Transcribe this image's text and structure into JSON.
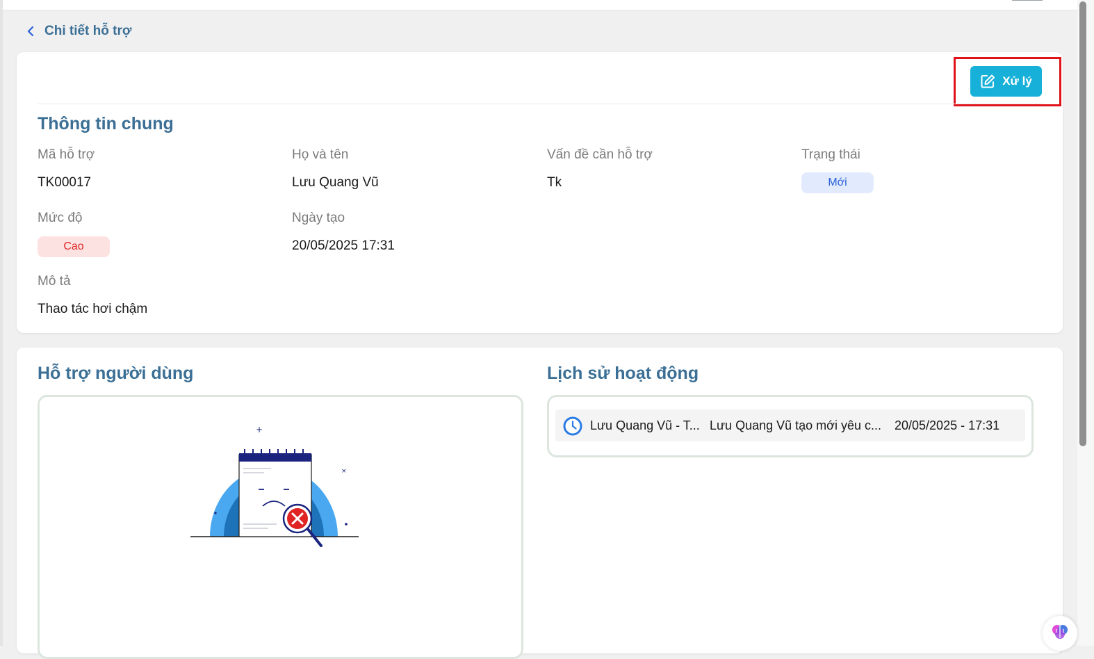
{
  "header": {
    "title": "Chi tiết hỗ trợ",
    "back_icon": "chevron-left-icon"
  },
  "actions": {
    "process_label": "Xử lý",
    "process_icon": "edit-icon",
    "process_color": "#17b0d9",
    "highlight_color": "#e1131a"
  },
  "general": {
    "title": "Thông tin chung",
    "fields": {
      "ticket_code": {
        "label": "Mã hỗ trợ",
        "value": "TK00017"
      },
      "full_name": {
        "label": "Họ và tên",
        "value": "Lưu Quang Vũ"
      },
      "issue": {
        "label": "Vấn đề cần hỗ trợ",
        "value": "Tk"
      },
      "status": {
        "label": "Trạng thái",
        "value": "Mới"
      },
      "priority": {
        "label": "Mức độ",
        "value": "Cao"
      },
      "created_at": {
        "label": "Ngày tạo",
        "value": "20/05/2025 17:31"
      },
      "description": {
        "label": "Mô tả",
        "value": "Thao tác hơi chậm"
      }
    }
  },
  "support": {
    "title": "Hỗ trợ người dùng",
    "empty_icon": "no-results-illustration"
  },
  "history": {
    "title": "Lịch sử hoạt động",
    "items": [
      {
        "icon": "clock-icon",
        "actor": "Lưu Quang Vũ - T...",
        "action": "Lưu Quang Vũ tạo mới yêu c...",
        "time": "20/05/2025 - 17:31"
      }
    ]
  },
  "colors": {
    "heading": "#3b6f95",
    "status_new_bg": "#e2ebfd",
    "status_new_text": "#2a60d8",
    "priority_high_bg": "#fde2e2",
    "priority_high_text": "#e02424"
  },
  "floating": {
    "icon": "ai-brain-icon"
  }
}
